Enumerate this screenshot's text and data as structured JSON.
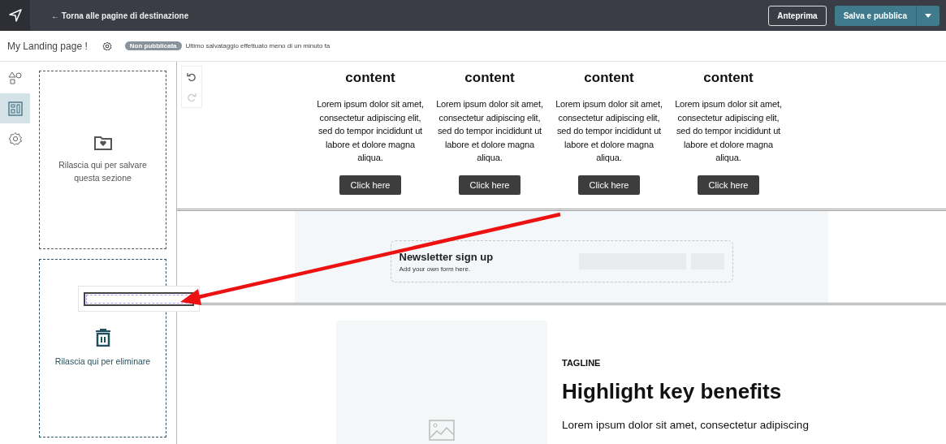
{
  "top_bar": {
    "back_link": "← Torna alle pagine di destinazione",
    "preview_button": "Anteprima",
    "publish_button": "Salva e pubblica"
  },
  "page_bar": {
    "page_name": "My Landing page !",
    "status_badge": "Non pubblicata",
    "save_status": "Ultimo salvataggio effettuato meno di un minuto fa"
  },
  "rail": [
    {
      "kind": "shapes",
      "selected": false
    },
    {
      "kind": "layout",
      "selected": true
    },
    {
      "kind": "settings",
      "selected": false
    }
  ],
  "drop_zones": [
    {
      "kind": "save",
      "label": "Rilascia qui per salvare questa sezione"
    },
    {
      "kind": "delete",
      "label": "Rilascia qui per eliminare"
    }
  ],
  "history": [
    {
      "kind": "undo",
      "disabled": false
    },
    {
      "kind": "redo",
      "disabled": true
    }
  ],
  "columns": [
    {
      "title": "content",
      "text": "Lorem ipsum dolor sit amet, consectetur adipiscing elit, sed do tempor incididunt ut labore et dolore magna aliqua.",
      "button": "Click here"
    },
    {
      "title": "content",
      "text": "Lorem ipsum dolor sit amet, consectetur adipiscing elit, sed do tempor incididunt ut labore et dolore magna aliqua.",
      "button": "Click here"
    },
    {
      "title": "content",
      "text": "Lorem ipsum dolor sit amet, consectetur adipiscing elit, sed do tempor incididunt ut labore et dolore magna aliqua.",
      "button": "Click here"
    },
    {
      "title": "content",
      "text": "Lorem ipsum dolor sit amet, consectetur adipiscing elit, sed do tempor incididunt ut labore et dolore magna aliqua.",
      "button": "Click here"
    }
  ],
  "newsletter": {
    "title": "Newsletter sign up",
    "subtitle": "Add your own form here."
  },
  "feature": {
    "tagline": "TAGLINE",
    "heading": "Highlight key benefits",
    "text": "Lorem ipsum dolor sit amet, consectetur adipiscing"
  }
}
